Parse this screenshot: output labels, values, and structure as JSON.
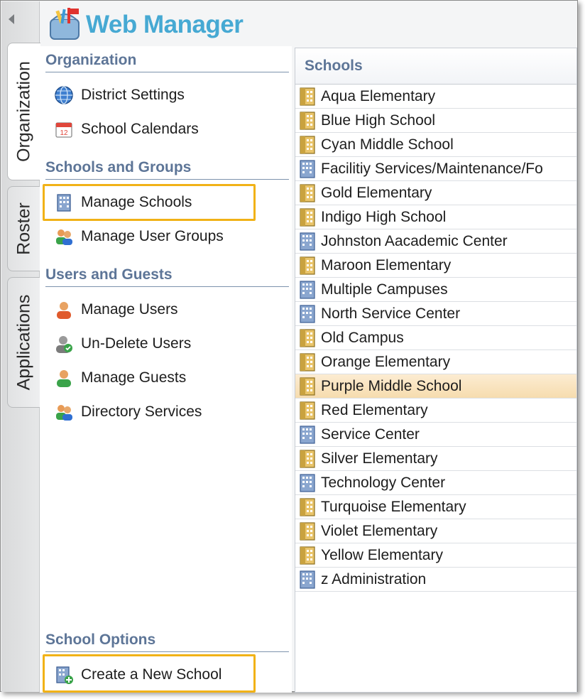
{
  "app": {
    "title": "Web Manager"
  },
  "tabs": [
    {
      "label": "Organization",
      "active": true
    },
    {
      "label": "Roster",
      "active": false
    },
    {
      "label": "Applications",
      "active": false
    }
  ],
  "nav": {
    "sections": [
      {
        "title": "Organization",
        "items": [
          {
            "label": "District Settings",
            "icon": "globe-icon"
          },
          {
            "label": "School Calendars",
            "icon": "calendar-icon"
          }
        ]
      },
      {
        "title": "Schools and Groups",
        "items": [
          {
            "label": "Manage Schools",
            "icon": "building-icon",
            "highlighted": true
          },
          {
            "label": "Manage User Groups",
            "icon": "user-group-icon"
          }
        ]
      },
      {
        "title": "Users and Guests",
        "items": [
          {
            "label": "Manage Users",
            "icon": "user-icon"
          },
          {
            "label": "Un-Delete Users",
            "icon": "user-restore-icon"
          },
          {
            "label": "Manage Guests",
            "icon": "guest-icon"
          },
          {
            "label": "Directory Services",
            "icon": "directory-icon"
          }
        ]
      },
      {
        "title": "School Options",
        "items": [
          {
            "label": "Create a New School",
            "icon": "add-building-icon",
            "highlighted": true
          }
        ]
      }
    ]
  },
  "schools": {
    "header": "Schools",
    "selected": "Purple Middle School",
    "items": [
      {
        "name": "Aqua Elementary",
        "type": "school"
      },
      {
        "name": "Blue High School",
        "type": "school"
      },
      {
        "name": "Cyan Middle School",
        "type": "school"
      },
      {
        "name": "Facilitiy Services/Maintenance/Fo",
        "type": "office"
      },
      {
        "name": "Gold Elementary",
        "type": "school"
      },
      {
        "name": "Indigo High School",
        "type": "school"
      },
      {
        "name": "Johnston Aacademic Center",
        "type": "office"
      },
      {
        "name": "Maroon Elementary",
        "type": "school"
      },
      {
        "name": "Multiple Campuses",
        "type": "office"
      },
      {
        "name": "North Service Center",
        "type": "office"
      },
      {
        "name": "Old Campus",
        "type": "school"
      },
      {
        "name": "Orange Elementary",
        "type": "school"
      },
      {
        "name": "Purple Middle School",
        "type": "school"
      },
      {
        "name": "Red Elementary",
        "type": "school"
      },
      {
        "name": "Service Center",
        "type": "office"
      },
      {
        "name": "Silver Elementary",
        "type": "school"
      },
      {
        "name": "Technology Center",
        "type": "office"
      },
      {
        "name": "Turquoise Elementary",
        "type": "school"
      },
      {
        "name": "Violet Elementary",
        "type": "school"
      },
      {
        "name": "Yellow Elementary",
        "type": "school"
      },
      {
        "name": "z Administration",
        "type": "office"
      }
    ]
  },
  "colors": {
    "accent": "#46a9d3",
    "section": "#5d7597",
    "highlight": "#f1b217",
    "selected": "#f8e0b6"
  }
}
